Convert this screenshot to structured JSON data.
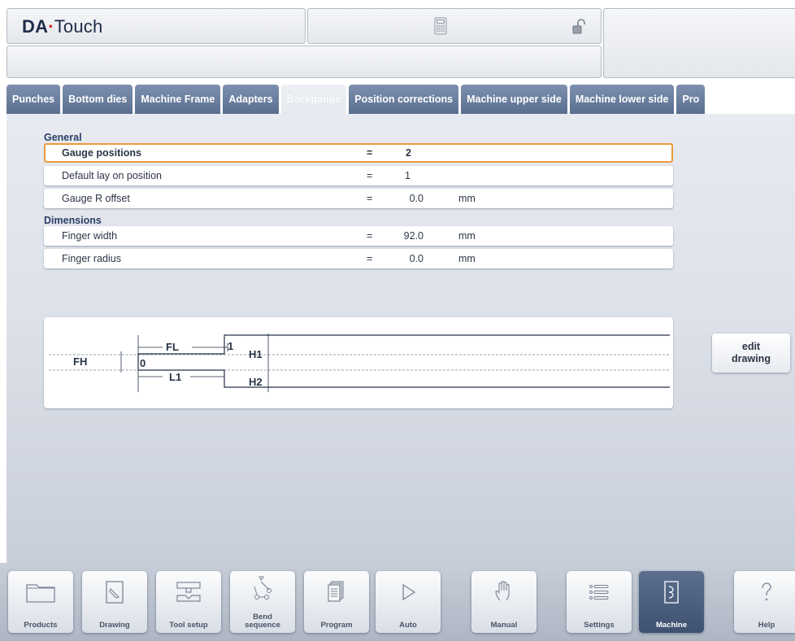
{
  "header": {
    "brand_bold": "DA",
    "brand_dot": "·",
    "brand_rest": "Touch"
  },
  "tabs": [
    {
      "label": "Punches",
      "active": false
    },
    {
      "label": "Bottom dies",
      "active": false
    },
    {
      "label": "Machine Frame",
      "active": false
    },
    {
      "label": "Adapters",
      "active": false
    },
    {
      "label": "Backgauge",
      "active": true
    },
    {
      "label": "Position corrections",
      "active": false
    },
    {
      "label": "Machine upper side",
      "active": false
    },
    {
      "label": "Machine lower side",
      "active": false
    },
    {
      "label": "Pro",
      "active": false
    }
  ],
  "general": {
    "title": "General",
    "rows": [
      {
        "label": "Gauge positions",
        "eq": "=",
        "value": "2",
        "unit": ""
      },
      {
        "label": "Default lay on position",
        "eq": "=",
        "value": "1",
        "unit": ""
      },
      {
        "label": "Gauge R offset",
        "eq": "=",
        "value": "0.0",
        "unit": "mm"
      }
    ]
  },
  "dimensions": {
    "title": "Dimensions",
    "rows": [
      {
        "label": "Finger width",
        "eq": "=",
        "value": "92.0",
        "unit": "mm"
      },
      {
        "label": "Finger radius",
        "eq": "=",
        "value": "0.0",
        "unit": "mm"
      }
    ]
  },
  "drawing": {
    "fh": "FH",
    "fl": "FL",
    "l1": "L1",
    "h1": "H1",
    "h2": "H2",
    "zero": "0",
    "one": "1"
  },
  "edit_drawing": {
    "line1": "edit",
    "line2": "drawing"
  },
  "nav": [
    {
      "label": "Products",
      "icon": "folder-icon",
      "active": false
    },
    {
      "label": "Drawing",
      "icon": "pencil-icon",
      "active": false
    },
    {
      "label": "Tool setup",
      "icon": "tool-setup-icon",
      "active": false
    },
    {
      "label": "Bend sequence",
      "icon": "bend-sequence-icon",
      "active": false
    },
    {
      "label": "Program",
      "icon": "program-icon",
      "active": false
    },
    {
      "label": "Auto",
      "icon": "play-icon",
      "active": false
    },
    {
      "label": "Manual",
      "icon": "hand-icon",
      "active": false
    },
    {
      "label": "Settings",
      "icon": "list-icon",
      "active": false
    },
    {
      "label": "Machine",
      "icon": "machine-icon",
      "active": true
    },
    {
      "label": "Help",
      "icon": "question-icon",
      "active": false
    }
  ],
  "colors": {
    "tab": "#6b7f9f",
    "selected_border": "#ee9a3a",
    "brand_dot": "#d02020"
  }
}
